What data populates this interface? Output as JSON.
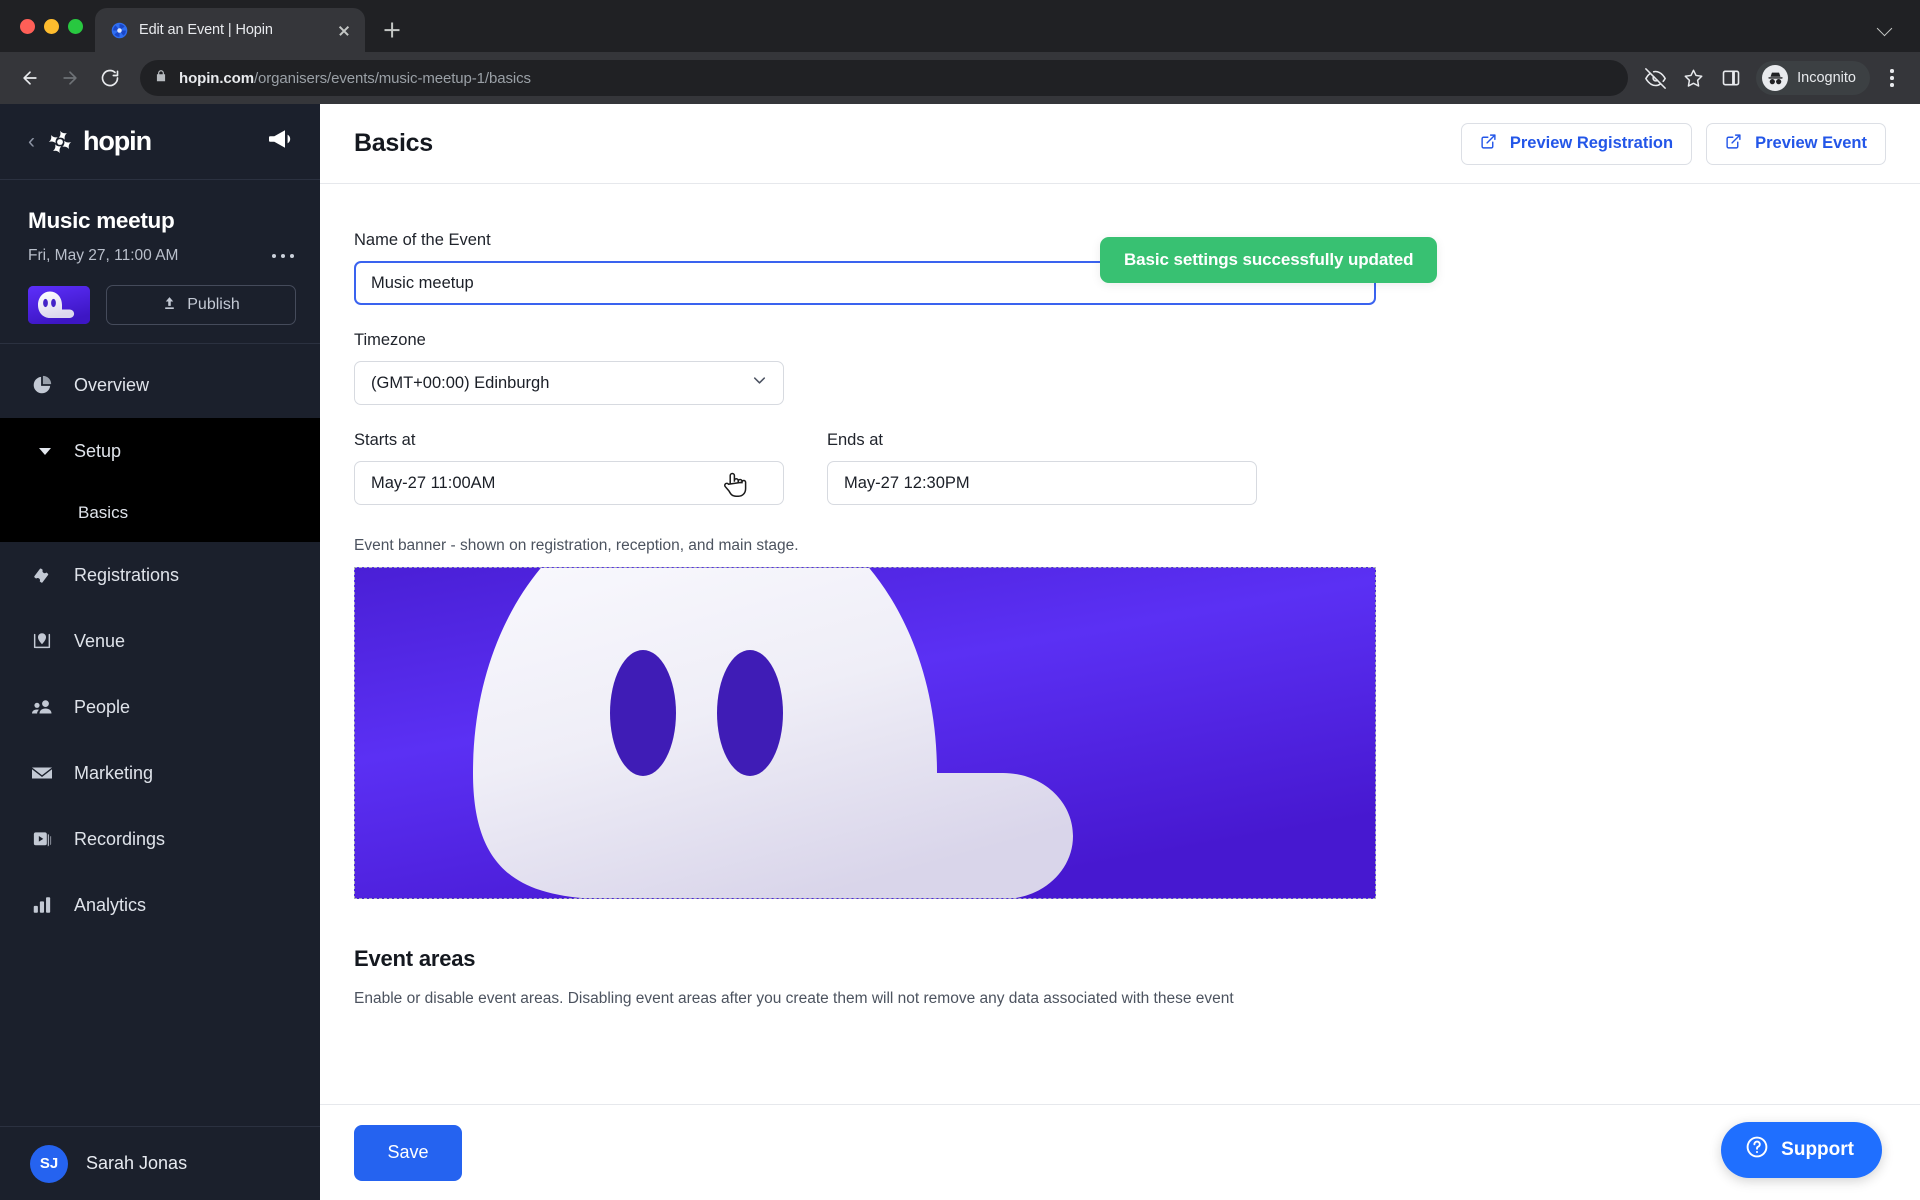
{
  "browser": {
    "tab": {
      "title": "Edit an Event | Hopin",
      "favicon_icon": "hopin-favicon"
    },
    "new_tab_label": "+",
    "url_domain": "hopin.com",
    "url_path": "/organisers/events/music-meetup-1/basics",
    "incognito_label": "Incognito",
    "icons": {
      "back": "back-arrow-icon",
      "forward": "forward-arrow-icon",
      "reload": "reload-icon",
      "lock": "lock-icon",
      "eye_off": "eye-off-icon",
      "bookmark": "star-icon",
      "side_panel": "side-panel-icon",
      "incognito": "incognito-icon",
      "menu": "kebab-menu-icon",
      "tab_search": "chevron-down-icon"
    }
  },
  "sidebar": {
    "brand": "hopin",
    "back_icon": "chevron-left-icon",
    "megaphone_icon": "megaphone-icon",
    "event": {
      "name": "Music meetup",
      "date": "Fri, May 27, 11:00 AM",
      "more_icon": "ellipsis-icon",
      "publish_label": "Publish",
      "publish_icon": "upload-icon",
      "thumbnail_icon": "event-thumbnail"
    },
    "nav": [
      {
        "label": "Overview",
        "icon": "pie-chart-icon",
        "active": false,
        "sub": false
      },
      {
        "label": "Setup",
        "icon": "caret-down-icon",
        "active": true,
        "sub": false
      },
      {
        "label": "Basics",
        "icon": "",
        "active": true,
        "sub": true
      },
      {
        "label": "Registrations",
        "icon": "ticket-icon",
        "active": false,
        "sub": false
      },
      {
        "label": "Venue",
        "icon": "map-pin-icon",
        "active": false,
        "sub": false
      },
      {
        "label": "People",
        "icon": "people-icon",
        "active": false,
        "sub": false
      },
      {
        "label": "Marketing",
        "icon": "envelope-icon",
        "active": false,
        "sub": false
      },
      {
        "label": "Recordings",
        "icon": "video-icon",
        "active": false,
        "sub": false
      },
      {
        "label": "Analytics",
        "icon": "bar-chart-icon",
        "active": false,
        "sub": false
      }
    ],
    "user": {
      "initials": "SJ",
      "name": "Sarah Jonas"
    }
  },
  "header": {
    "title": "Basics",
    "preview_registration": "Preview Registration",
    "preview_event": "Preview Event",
    "external_link_icon": "external-link-icon"
  },
  "toast": {
    "message": "Basic settings successfully updated",
    "color": "#38c172"
  },
  "form": {
    "name_label": "Name of the Event",
    "name_value": "Music meetup",
    "timezone_label": "Timezone",
    "timezone_value": "(GMT+00:00) Edinburgh",
    "timezone_caret_icon": "chevron-down-icon",
    "starts_label": "Starts at",
    "starts_value": "May-27 11:00AM",
    "ends_label": "Ends at",
    "ends_value": "May-27 12:30PM",
    "banner_note": "Event banner - shown on registration, reception, and main stage.",
    "banner_alt": "event-banner-image"
  },
  "event_areas": {
    "title": "Event areas",
    "description": "Enable or disable event areas. Disabling event areas after you create them will not remove any data associated with these event"
  },
  "footer": {
    "save_label": "Save",
    "support_label": "Support",
    "support_icon": "question-circle-icon"
  },
  "colors": {
    "accent_blue": "#2563f0",
    "sidebar_bg": "#1b202c",
    "active_nav_bg": "#000000",
    "toast_green": "#38c172",
    "banner_purple": "#5a2ef2"
  }
}
